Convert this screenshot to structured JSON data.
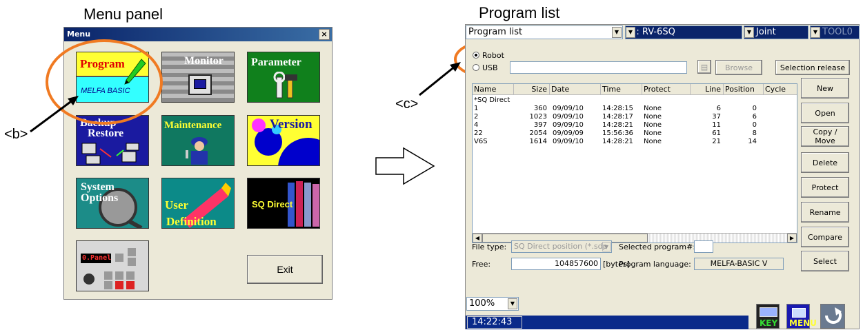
{
  "captions": {
    "menu_panel": "Menu panel",
    "program_list": "Program list",
    "label_b": "<b>",
    "label_c": "<c>"
  },
  "menu_window": {
    "title": "Menu",
    "close": "×",
    "tiles": {
      "program": "Program",
      "program_sub": "MELFA BASIC",
      "monitor": "Monitor",
      "parameter": "Parameter",
      "backup": "Backup",
      "restore": "Restore",
      "maintenance": "Maintenance",
      "version": "Version",
      "system": "System",
      "options": "Options",
      "user": "User",
      "definition": "Definition",
      "sq_direct": "SQ Direct",
      "panel": "0.Panel"
    },
    "exit_label": "Exit"
  },
  "program_window": {
    "view_combo": "Program list",
    "robot_combo": "1 : RV-6SQ",
    "jog_combo": "Joint",
    "tool_combo": "TOOL0",
    "radio_robot": "Robot",
    "radio_usb": "USB",
    "browse_label": "Browse",
    "selection_release_label": "Selection release",
    "columns": [
      "Name",
      "Size",
      "Date",
      "Time",
      "Protect",
      "Line",
      "Position",
      "Cycle"
    ],
    "rows": [
      {
        "name": "*SQ Direct",
        "size": "",
        "date": "",
        "time": "",
        "protect": "",
        "line": "",
        "position": ""
      },
      {
        "name": "1",
        "size": "360",
        "date": "09/09/10",
        "time": "14:28:15",
        "protect": "None",
        "line": "6",
        "position": "0"
      },
      {
        "name": "2",
        "size": "1023",
        "date": "09/09/10",
        "time": "14:28:17",
        "protect": "None",
        "line": "37",
        "position": "6"
      },
      {
        "name": "4",
        "size": "397",
        "date": "09/09/10",
        "time": "14:28:21",
        "protect": "None",
        "line": "11",
        "position": "0"
      },
      {
        "name": "22",
        "size": "2054",
        "date": "09/09/09",
        "time": "15:56:36",
        "protect": "None",
        "line": "61",
        "position": "8"
      },
      {
        "name": "V6S",
        "size": "1614",
        "date": "09/09/10",
        "time": "14:28:21",
        "protect": "None",
        "line": "21",
        "position": "14"
      }
    ],
    "side_buttons": [
      "New",
      "Open",
      "Copy /\nMove",
      "Delete",
      "Protect",
      "Rename",
      "Compare",
      "Select"
    ],
    "file_type_label": "File type:",
    "file_type_value": "SQ Direct position (*.sdp",
    "selected_program_label": "Selected program#:",
    "free_label": "Free:",
    "free_value": "104857600",
    "free_unit": "[bytes]",
    "program_language_label": "Program language:",
    "program_language_value": "MELFA-BASIC V",
    "zoom_value": "100%",
    "clock": "14:22:43",
    "key_label": "KEY",
    "menu_label": "MENU"
  }
}
